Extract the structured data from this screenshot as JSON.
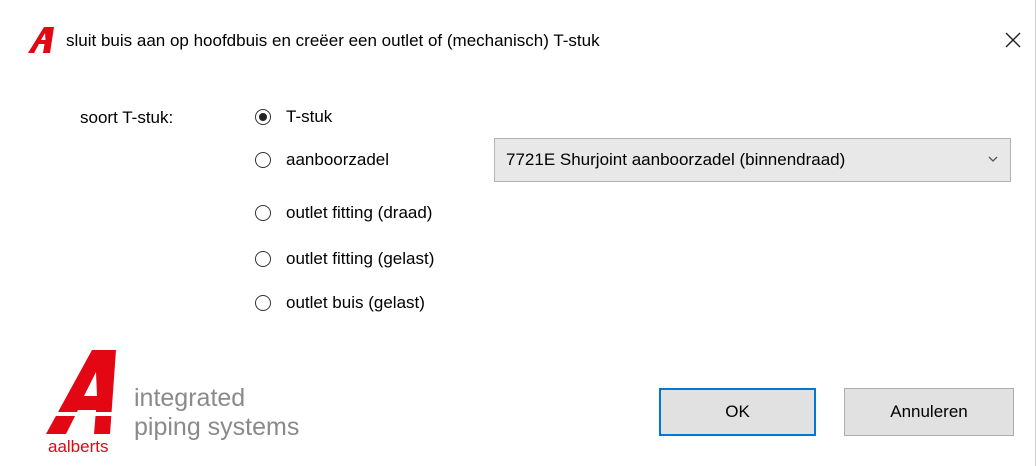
{
  "dialog": {
    "title": "sluit buis aan op hoofdbuis en creëer een outlet of (mechanisch) T-stuk",
    "close_glyph": "✕",
    "icons": {
      "app": "aalberts-a-logo-icon",
      "close": "close-icon"
    }
  },
  "form": {
    "type_label": "soort T-stuk:",
    "options": [
      {
        "label": "T-stuk",
        "selected": true
      },
      {
        "label": "aanboorzadel",
        "selected": false
      },
      {
        "label": "outlet fitting (draad)",
        "selected": false
      },
      {
        "label": "outlet fitting (gelast)",
        "selected": false
      },
      {
        "label": "outlet buis (gelast)",
        "selected": false
      }
    ],
    "saddle_select": {
      "value": "7721E Shurjoint aanboorzadel (binnendraad)"
    }
  },
  "buttons": {
    "ok": "OK",
    "cancel": "Annuleren"
  },
  "branding": {
    "line1": "integrated",
    "line2": "piping systems",
    "wordmark": "aalberts",
    "brand_color": "#e30613"
  }
}
